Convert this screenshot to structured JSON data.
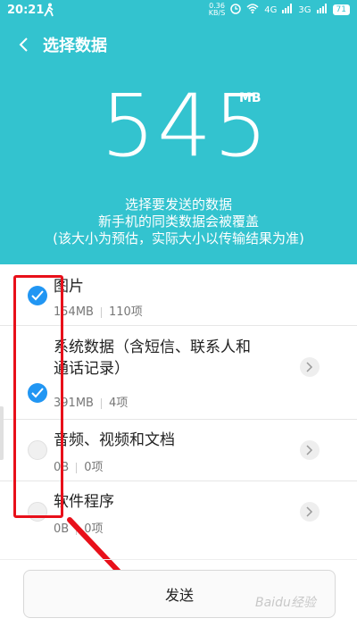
{
  "status_bar": {
    "time": "20:21",
    "speed_value": "0.36",
    "speed_unit": "KB/S",
    "signal_1": "4G",
    "signal_2": "3G",
    "battery": "71"
  },
  "header": {
    "title": "选择数据"
  },
  "summary": {
    "size": "545",
    "unit": "MB",
    "line1": "选择要发送的数据",
    "line2": "新手机的同类数据会被覆盖",
    "line3": "(该大小为预估，实际大小以传输结果为准)"
  },
  "items": [
    {
      "name": "图片",
      "size": "154MB",
      "count": "110项",
      "checked": true
    },
    {
      "name_line1": "系统数据（含短信、联系人和",
      "name_line2": "通话记录）",
      "size": "391MB",
      "count": "4项",
      "checked": true
    },
    {
      "name": "音频、视频和文档",
      "size": "0B",
      "count": "0项",
      "checked": false
    },
    {
      "name": "软件程序",
      "size": "0B",
      "count": "0项",
      "checked": false
    }
  ],
  "send_button": {
    "label": "发送"
  },
  "watermark": "Baidu经验",
  "colors": {
    "header_bg": "#33c3cf",
    "check_on": "#2196f3",
    "annotation": "#e8101a"
  },
  "icons": [
    "back-arrow-icon",
    "checkmark-icon",
    "chevron-right-icon"
  ]
}
